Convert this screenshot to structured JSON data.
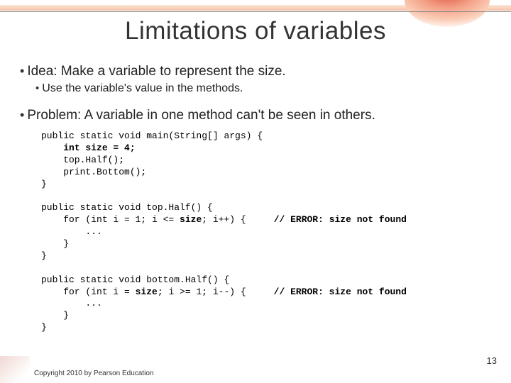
{
  "title": "Limitations of variables",
  "bullets": {
    "idea": "Idea: Make a variable to represent the size.",
    "idea_sub": "Use the variable's value in the methods.",
    "problem": "Problem: A variable in one method can't be seen in others."
  },
  "code": "public static void main(String[] args) {\n    int size = 4;\n    top.Half();\n    print.Bottom();\n}\n\npublic static void top.Half() {\n    for (int i = 1; i <= size; i++) {     // ERROR: size not found\n        ...\n    }\n}\n\npublic static void bottom.Half() {\n    for (int i = size; i >= 1; i--) {     // ERROR: size not found\n        ...\n    }\n}",
  "code_lines": [
    {
      "t": "public static void main(String[] args) {",
      "bold": []
    },
    {
      "t": "    int size = 4;",
      "bold": [
        [
          4,
          17
        ]
      ]
    },
    {
      "t": "    top.Half();",
      "bold": []
    },
    {
      "t": "    print.Bottom();",
      "bold": []
    },
    {
      "t": "}",
      "bold": []
    },
    {
      "t": "",
      "bold": []
    },
    {
      "t": "public static void top.Half() {",
      "bold": []
    },
    {
      "t": "    for (int i = 1; i <= size; i++) {     // ERROR: size not found",
      "bold": [
        [
          25,
          29
        ],
        [
          42,
          69
        ]
      ]
    },
    {
      "t": "        ...",
      "bold": []
    },
    {
      "t": "    }",
      "bold": []
    },
    {
      "t": "}",
      "bold": []
    },
    {
      "t": "",
      "bold": []
    },
    {
      "t": "public static void bottom.Half() {",
      "bold": []
    },
    {
      "t": "    for (int i = size; i >= 1; i--) {     // ERROR: size not found",
      "bold": [
        [
          17,
          21
        ],
        [
          42,
          69
        ]
      ]
    },
    {
      "t": "        ...",
      "bold": []
    },
    {
      "t": "    }",
      "bold": []
    },
    {
      "t": "}",
      "bold": []
    }
  ],
  "footer": "Copyright 2010 by Pearson Education",
  "page_number": "13"
}
